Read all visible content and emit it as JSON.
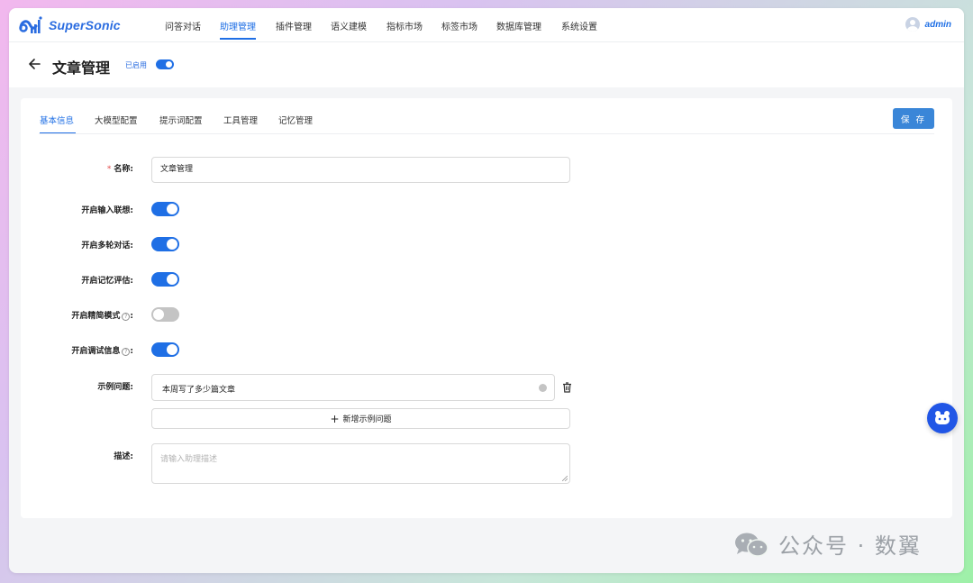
{
  "brand": {
    "name": "SuperSonic",
    "accent": "#1f6fe5"
  },
  "nav": {
    "items": [
      {
        "label": "问答对话",
        "active": false
      },
      {
        "label": "助理管理",
        "active": true
      },
      {
        "label": "插件管理",
        "active": false
      },
      {
        "label": "语义建模",
        "active": false
      },
      {
        "label": "指标市场",
        "active": false
      },
      {
        "label": "标签市场",
        "active": false
      },
      {
        "label": "数据库管理",
        "active": false
      },
      {
        "label": "系统设置",
        "active": false
      }
    ],
    "user": {
      "name": "admin",
      "icon": "user-avatar-icon"
    }
  },
  "header": {
    "back_icon": "arrow-left-icon",
    "title": "文章管理",
    "status_label": "已启用",
    "enabled": true
  },
  "tabs": [
    {
      "label": "基本信息",
      "active": true
    },
    {
      "label": "大模型配置",
      "active": false
    },
    {
      "label": "提示词配置",
      "active": false
    },
    {
      "label": "工具管理",
      "active": false
    },
    {
      "label": "记忆管理",
      "active": false
    }
  ],
  "save_label": "保 存",
  "form": {
    "name": {
      "label": "名称:",
      "required_mark": "*",
      "value": "文章管理"
    },
    "input_suggest": {
      "label": "开启输入联想:",
      "enabled": true
    },
    "multi_turn": {
      "label": "开启多轮对话:",
      "enabled": true
    },
    "memory_eval": {
      "label": "开启记忆评估:",
      "enabled": true
    },
    "simple_mode": {
      "label": "开启精简模式",
      "suffix": ":",
      "enabled": false,
      "help_icon": "question-circle-icon"
    },
    "debug_info": {
      "label": "开启调试信息",
      "suffix": ":",
      "enabled": true,
      "help_icon": "question-circle-icon"
    },
    "examples": {
      "label": "示例问题:",
      "items": [
        "本周写了多少篇文章"
      ],
      "add_label": "新增示例问题"
    },
    "description": {
      "label": "描述:",
      "placeholder": "请输入助理描述",
      "value": ""
    }
  },
  "watermark": {
    "text": "公众号 · 数翼",
    "icon": "wechat-icon"
  }
}
